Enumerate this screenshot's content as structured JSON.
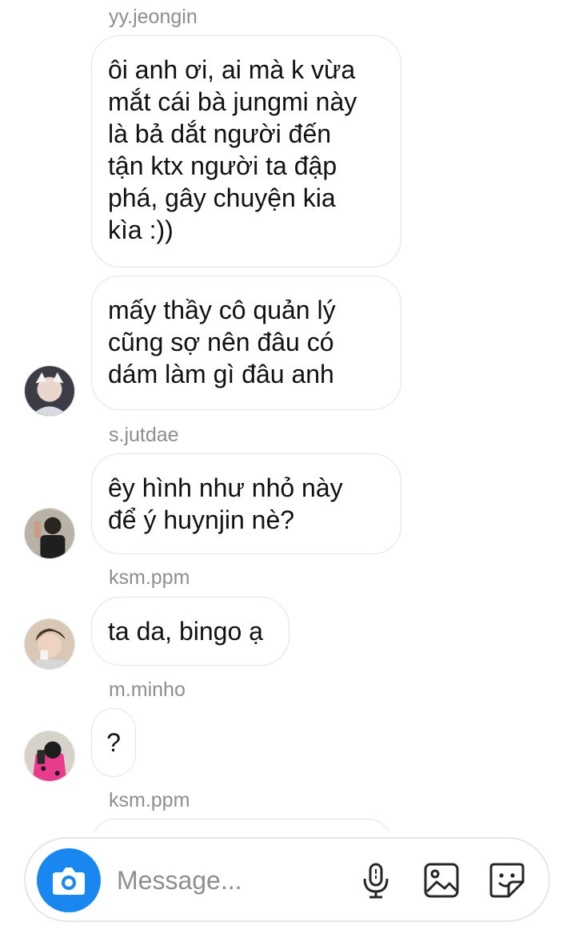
{
  "messages": [
    {
      "sender": "yy.jeongin",
      "bubbles": [
        "ôi anh ơi, ai mà k vừa\nmắt cái bà jungmi này\nlà bả dắt người đến\ntận ktx người ta đập\nphá, gây chuyện kia\nkìa :))",
        "mấy thầy cô quản lý\ncũng sợ nên đâu có\ndám làm gì đâu anh"
      ]
    },
    {
      "sender": "s.jutdae",
      "bubbles": [
        "êy hình như nhỏ này\nđể ý huynjin nè?"
      ]
    },
    {
      "sender": "ksm.ppm",
      "bubbles": [
        "ta da, bingo ạ"
      ]
    },
    {
      "sender": "m.minho",
      "bubbles": [
        "?"
      ]
    },
    {
      "sender": "ksm.ppm",
      "bubbles": []
    }
  ],
  "composer": {
    "placeholder": "Message...",
    "icons": [
      "camera-icon",
      "microphone-icon",
      "gallery-icon",
      "sticker-icon"
    ],
    "camera_color": "#1a87f1"
  }
}
